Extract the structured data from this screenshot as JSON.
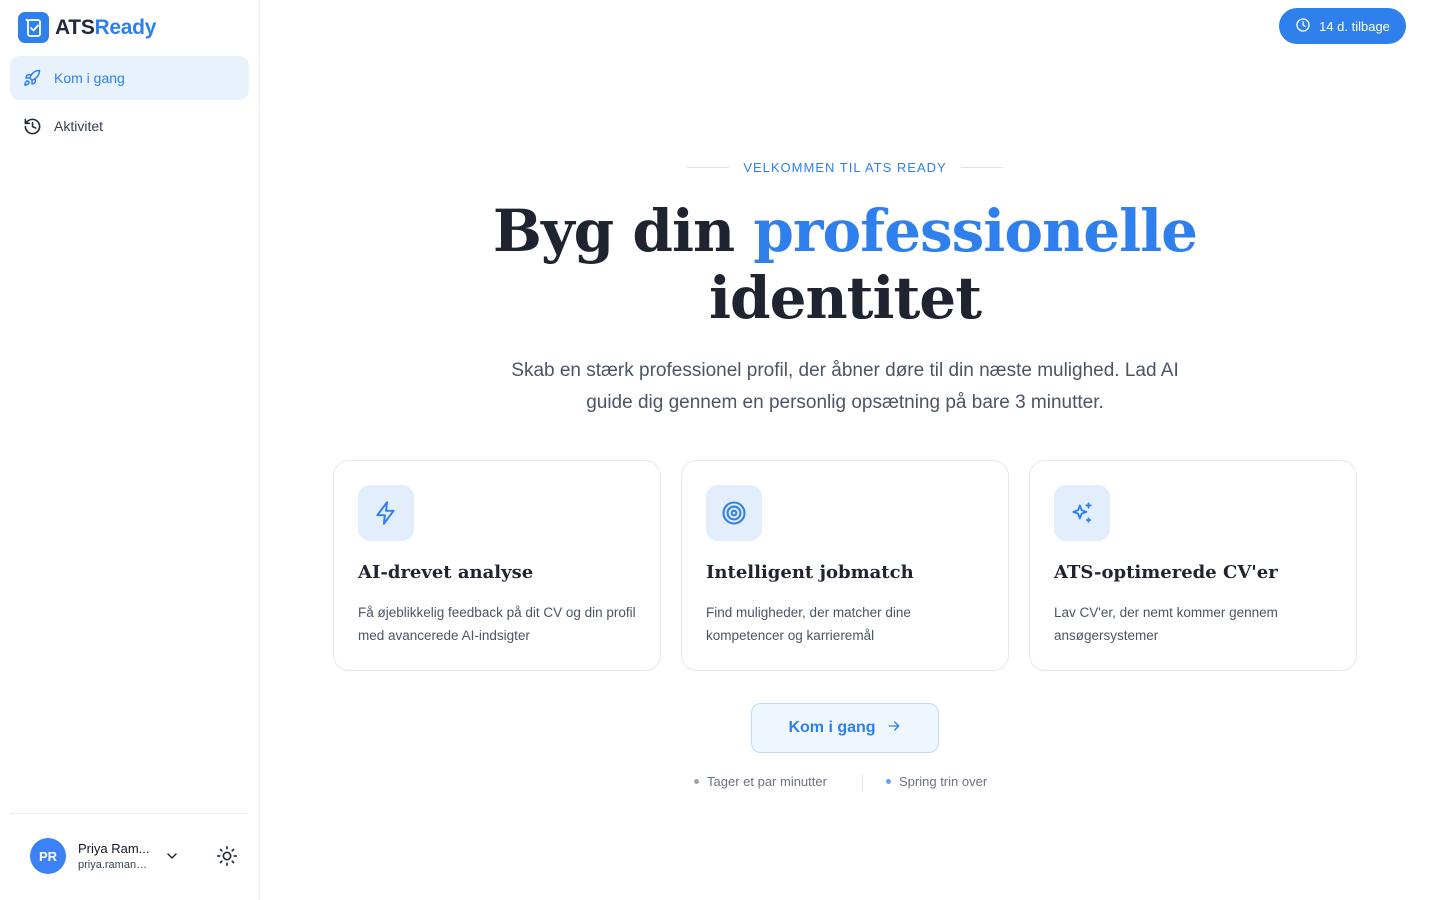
{
  "app": {
    "logo_prefix": "ATS",
    "logo_suffix": "Ready",
    "brand_color": "#2f80ed"
  },
  "sidebar": {
    "items": [
      {
        "label": "Kom i gang",
        "icon": "rocket-icon",
        "active": true
      },
      {
        "label": "Aktivitet",
        "icon": "history-icon",
        "active": false
      }
    ],
    "user": {
      "initials": "PR",
      "name": "Priya Ram...",
      "email": "priya.raman@..."
    }
  },
  "trial": {
    "label": "14 d. tilbage",
    "icon": "clock-icon"
  },
  "hero": {
    "eyebrow": "VELKOMMEN TIL ATS READY",
    "headline_pre": "Byg din ",
    "headline_highlight": "professionelle",
    "headline_line2": "identitet",
    "subtitle": "Skab en stærk professionel profil, der åbner døre til din næste mulighed. Lad AI guide dig gennem en personlig opsætning på bare 3 minutter."
  },
  "features": [
    {
      "icon": "lightning-icon",
      "title": "AI-drevet analyse",
      "desc": "Få øjeblikkelig feedback på dit CV og din profil med avancerede AI-indsigter"
    },
    {
      "icon": "target-icon",
      "title": "Intelligent jobmatch",
      "desc": "Find muligheder, der matcher dine kompetencer og karrieremål"
    },
    {
      "icon": "sparkles-icon",
      "title": "ATS-optimerede CV'er",
      "desc": "Lav CV'er, der nemt kommer gennem ansøgersystemer"
    }
  ],
  "cta": {
    "label": "Kom i gang"
  },
  "meta": {
    "left": "Tager et par minutter",
    "left_dot_color": "#9ca3af",
    "right": "Spring trin over",
    "right_dot_color": "#60a5fa"
  }
}
